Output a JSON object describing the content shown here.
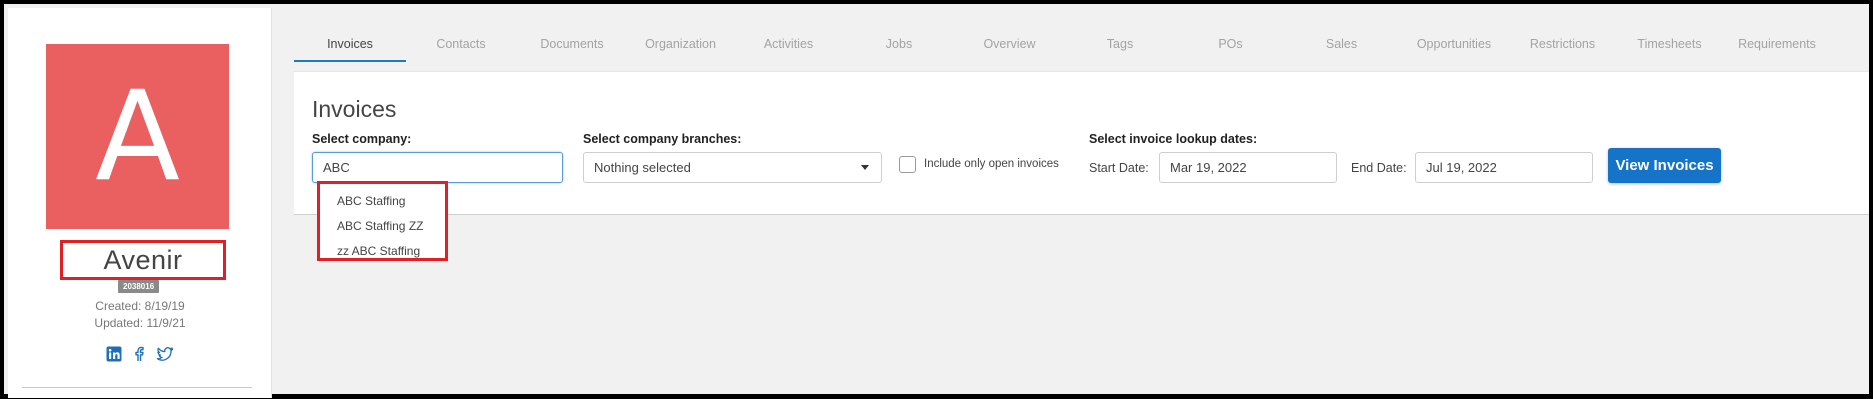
{
  "profile": {
    "avatar_letter": "A",
    "name": "Avenir",
    "id_badge": "2038016",
    "created": "Created: 8/19/19",
    "updated": "Updated: 11/9/21",
    "avatar_color": "#ea5f5f",
    "social_icons": [
      "linkedin-icon",
      "facebook-icon",
      "twitter-icon"
    ]
  },
  "tabs": [
    {
      "label": "Invoices",
      "active": true
    },
    {
      "label": "Contacts"
    },
    {
      "label": "Documents"
    },
    {
      "label": "Organization"
    },
    {
      "label": "Activities"
    },
    {
      "label": "Jobs"
    },
    {
      "label": "Overview"
    },
    {
      "label": "Tags"
    },
    {
      "label": "POs"
    },
    {
      "label": "Sales"
    },
    {
      "label": "Opportunities"
    },
    {
      "label": "Restrictions"
    },
    {
      "label": "Timesheets"
    },
    {
      "label": "Requirements"
    }
  ],
  "invoices": {
    "title": "Invoices",
    "company_label": "Select company:",
    "company_value": "ABC",
    "branches_label": "Select company branches:",
    "branches_value": "Nothing selected",
    "open_only_label": "Include only open invoices",
    "open_only_checked": false,
    "dates_label": "Select invoice lookup dates:",
    "start_label": "Start Date:",
    "start_value": "Mar 19, 2022",
    "end_label": "End Date:",
    "end_value": "Jul 19, 2022",
    "view_button": "View Invoices",
    "button_color": "#1573c8"
  },
  "company_suggestions": [
    "ABC Staffing",
    "ABC Staffing ZZ",
    "zz ABC Staffing"
  ],
  "highlight_color": "#e12026"
}
